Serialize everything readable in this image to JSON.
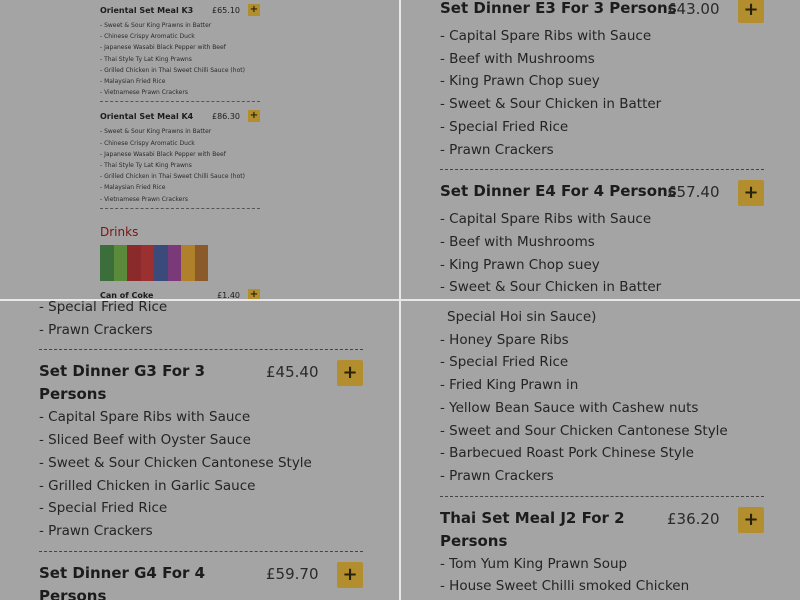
{
  "top_left": {
    "set_k3": {
      "title": "Oriental Set Meal K3",
      "price": "£65.10",
      "add": "+",
      "items": [
        "- Sweet & Sour King Prawns in Batter",
        "- Chinese Crispy Aromatic Duck",
        "- Japanese Wasabi Black Pepper with Beef",
        "- Thai Style Ty Lat King Prawns",
        "- Grilled Chicken in Thai Sweet Chilli Sauce (hot)",
        "- Malaysian Fried Rice",
        "- Vietnamese Prawn Crackers"
      ]
    },
    "set_k4": {
      "title": "Oriental Set Meal K4",
      "price": "£86.30",
      "add": "+",
      "items": [
        "- Sweet & Sour King Prawns in Batter",
        "- Chinese Crispy Aromatic Duck",
        "- Japanese Wasabi Black Pepper with Beef",
        "- Thai Style Ty Lat King Prawns",
        "- Grilled Chicken in Thai Sweet Chilli Sauce (hot)",
        "- Malaysian Fried Rice",
        "- Vietnamese Prawn Crackers"
      ]
    },
    "drinks_heading": "Drinks",
    "coke": {
      "title": "Can of Coke",
      "price": "£1.40",
      "add": "+"
    }
  },
  "top_right": {
    "e3": {
      "title": "Set Dinner E3 For 3 Persons",
      "price": "£43.00",
      "add": "+",
      "items": [
        "- Capital Spare Ribs with Sauce",
        "- Beef with Mushrooms",
        "- King Prawn Chop suey",
        "- Sweet & Sour Chicken in Batter",
        "- Special Fried Rice",
        "- Prawn Crackers"
      ]
    },
    "e4": {
      "title": "Set Dinner E4 For 4 Persons",
      "price": "£57.40",
      "add": "+",
      "items": [
        "- Capital Spare Ribs with Sauce",
        "- Beef with Mushrooms",
        "- King Prawn Chop suey",
        "- Sweet & Sour Chicken in Batter"
      ]
    }
  },
  "bottom_left": {
    "prev_items": [
      "- Special Fried Rice",
      "- Prawn Crackers"
    ],
    "g3": {
      "title_l1": "Set Dinner G3 For 3",
      "title_l2": "Persons",
      "price": "£45.40",
      "add": "+",
      "items": [
        "- Capital Spare Ribs with Sauce",
        "- Sliced Beef with Oyster Sauce",
        "- Sweet & Sour Chicken Cantonese Style",
        "- Grilled Chicken in Garlic Sauce",
        "- Special Fried Rice",
        "- Prawn Crackers"
      ]
    },
    "g4": {
      "title_l1": "Set Dinner G4 For 4",
      "title_l2": "Persons",
      "price": "£59.70",
      "add": "+"
    }
  },
  "bottom_right": {
    "prev_items": [
      "Special Hoi sin Sauce)",
      "- Honey Spare Ribs",
      "- Special Fried Rice",
      "- Fried King Prawn in",
      "- Yellow Bean Sauce with Cashew nuts",
      "- Sweet and Sour Chicken Cantonese Style",
      "- Barbecued Roast Pork Chinese Style",
      "- Prawn Crackers"
    ],
    "j2": {
      "title_l1": "Thai Set Meal J2 For 2",
      "title_l2": "Persons",
      "price": "£36.20",
      "add": "+",
      "items": [
        "- Tom Yum King Prawn Soup",
        "- House Sweet Chilli smoked Chicken"
      ]
    }
  },
  "colors": {
    "accent": "#b38e2e",
    "drinks": "#7a1515",
    "overlay": "#a4a4a4"
  }
}
